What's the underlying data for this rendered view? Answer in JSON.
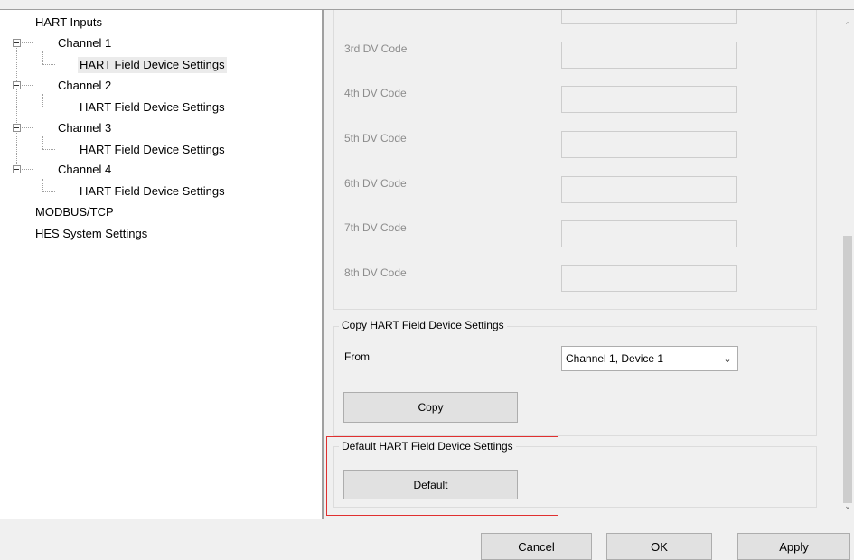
{
  "tree": {
    "items": [
      {
        "label": "HART Inputs"
      },
      {
        "label": "Channel 1"
      },
      {
        "label": "HART Field Device Settings"
      },
      {
        "label": "Channel 2"
      },
      {
        "label": "HART Field Device Settings"
      },
      {
        "label": "Channel 3"
      },
      {
        "label": "HART Field Device Settings"
      },
      {
        "label": "Channel 4"
      },
      {
        "label": "HART Field Device Settings"
      },
      {
        "label": "MODBUS/TCP"
      },
      {
        "label": "HES System Settings"
      }
    ]
  },
  "dv_codes": {
    "labels": [
      "3rd DV Code",
      "4th DV Code",
      "5th DV Code",
      "6th DV Code",
      "7th DV Code",
      "8th DV Code"
    ]
  },
  "copy_group": {
    "title": "Copy HART Field Device Settings",
    "from_label": "From",
    "from_value": "Channel 1, Device 1",
    "copy_label": "Copy"
  },
  "default_group": {
    "title": "Default HART Field Device Settings",
    "default_label": "Default",
    "highlight_color": "#e03030"
  },
  "footer": {
    "cancel_label": "Cancel",
    "ok_label": "OK",
    "apply_label": "Apply"
  }
}
